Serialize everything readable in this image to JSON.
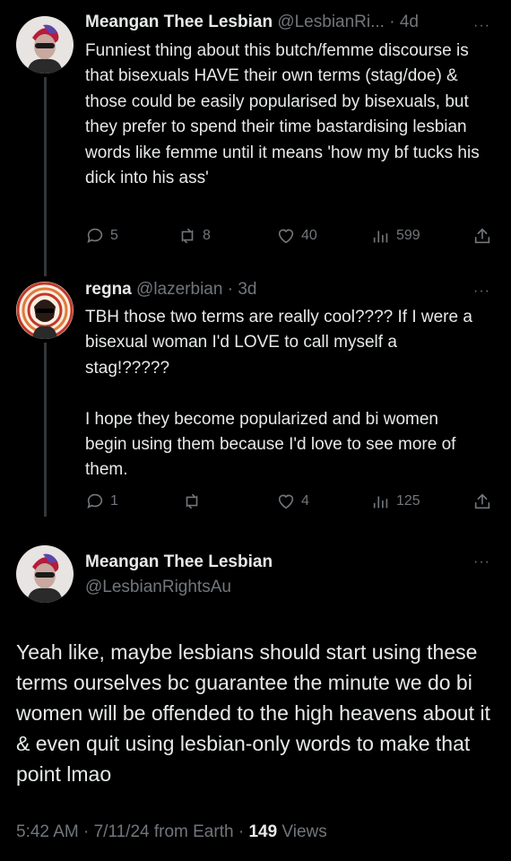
{
  "colors": {
    "background": "#000000",
    "text": "#e7e9ea",
    "muted": "#71767b",
    "thread_line": "#333639"
  },
  "tweet1": {
    "display_name": "Meangan Thee Lesbian",
    "handle": "@LesbianRi...",
    "separator": "·",
    "time": "4d",
    "more": "···",
    "text": "Funniest thing about this butch/femme discourse is that bisexuals HAVE their own terms (stag/doe) & those could be easily popularised by bisexuals, but they prefer to spend their time bastardising lesbian words like femme until it means 'how my bf tucks his dick into his ass'",
    "replies": "5",
    "reposts": "8",
    "likes": "40",
    "views": "599"
  },
  "tweet2": {
    "display_name": "regna",
    "handle": "@lazerbian",
    "separator": "·",
    "time": "3d",
    "more": "···",
    "text": "TBH those two terms are really cool???? If I were a bisexual woman I'd LOVE to call myself a stag!?????\n\nI hope they become popularized and bi women begin using them because I'd love to see more of them.",
    "replies": "1",
    "reposts": "",
    "likes": "4",
    "views": "125"
  },
  "main_tweet": {
    "display_name": "Meangan Thee Lesbian",
    "handle": "@LesbianRightsAu",
    "more": "···",
    "text": "Yeah like, maybe lesbians should start using these terms ourselves bc guarantee the minute we do bi women will be offended to the high heavens about it & even quit using lesbian-only words to make that point lmao",
    "timestamp": "5:42 AM · 7/11/24 from Earth · ",
    "views_count": "149",
    "views_label": " Views"
  },
  "icons": [
    "reply-icon",
    "repost-icon",
    "like-icon",
    "views-icon",
    "share-icon",
    "more-icon"
  ]
}
